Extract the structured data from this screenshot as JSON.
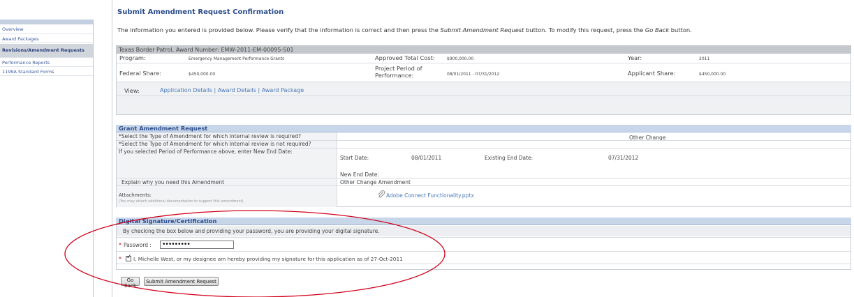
{
  "sidebar": {
    "items": [
      {
        "label": "Overview"
      },
      {
        "label": "Award Packages"
      },
      {
        "label": "Revisions/Amendment Requests"
      },
      {
        "label": "Performance Reports"
      },
      {
        "label": "1199A Standard Forms"
      }
    ]
  },
  "page": {
    "title": "Submit Amendment Request Confirmation",
    "instructions_pre": "The information you entered is provided below. Please verify that the information is correct and then press the ",
    "instructions_em1": "Submit Amendment Request",
    "instructions_mid": " button. To modify this request, press the ",
    "instructions_em2": "Go Back",
    "instructions_post": " button."
  },
  "award": {
    "header": "Texas Border Patrol, Award Number: EMW-2011-EM-00095-S01",
    "program_label": "Program:",
    "program_value": "Emergency Management Performance Grants",
    "approved_label": "Approved Total Cost:",
    "approved_value": "$900,000.00",
    "year_label": "Year:",
    "year_value": "2011",
    "federal_label": "Federal Share:",
    "federal_value": "$450,000.00",
    "period_label": "Project Period of Performance:",
    "period_value": "08/01/2011 - 07/31/2012",
    "applicant_label": "Applicant Share:",
    "applicant_value": "$450,000.00",
    "view_label": "View:",
    "links": [
      "Application Details",
      "Award Details",
      "Award Package"
    ],
    "sep": "|"
  },
  "amendment": {
    "header": "Grant Amendment Request",
    "row1_label": "*Select the Type of Amendment for which Internal review is required?",
    "row1_value": "Other Change",
    "row2_label": "*Select the Type of Amendment for which Internal review is not required?",
    "row3_label": "If you selected Period of Performance above, enter New End Date:",
    "start_label": "Start Date:",
    "start_value": "08/01/2011",
    "existing_label": "Existing End Date:",
    "existing_value": "07/31/2012",
    "new_end_label": "New End Date:",
    "explain_label": "Explain why you need this Amendment",
    "explain_value": "Other Change Amendment",
    "attachments_label": "Attachments:",
    "attachments_hint": "(You may attach additional documentation to support this amendment)",
    "attachment_file": "Adobe Connect Functionality.pptx"
  },
  "signature": {
    "header": "Digital Signature/Certification",
    "info": "By checking the box below and providing your password, you are providing your digital signature.",
    "required_mark": "*",
    "password_label": "Password :",
    "password_value": "•••••••••",
    "certify_text": "I, Michelle West, or my designee am hereby providing my signature for this application as of 27-Oct-2011",
    "certify_checked": true
  },
  "buttons": {
    "go_back": "Go Back",
    "submit": "Submit Amendment Request"
  },
  "colors": {
    "annotation": "#d0021b",
    "accent": "#2b4d8c",
    "link": "#4a78b8"
  }
}
